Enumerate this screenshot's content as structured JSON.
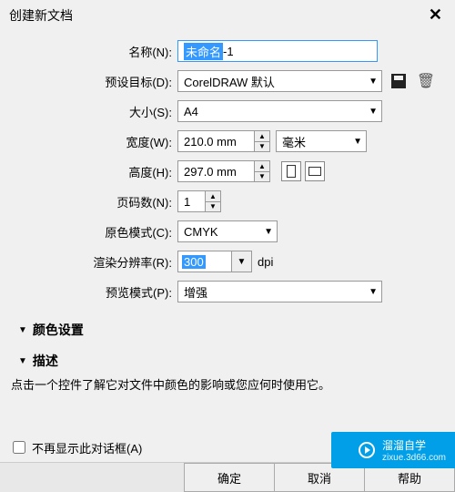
{
  "title": "创建新文档",
  "labels": {
    "name": "名称(N):",
    "preset": "预设目标(D):",
    "size": "大小(S):",
    "width": "宽度(W):",
    "height": "高度(H):",
    "pages": "页码数(N):",
    "colormode": "原色模式(C):",
    "resolution": "渲染分辨率(R):",
    "preview": "预览模式(P):"
  },
  "values": {
    "name_selected": "未命名",
    "name_rest": " -1",
    "preset": "CorelDRAW 默认",
    "size": "A4",
    "width": "210.0 mm",
    "height": "297.0 mm",
    "units": "毫米",
    "pages": "1",
    "colormode": "CMYK",
    "resolution": "300",
    "resolution_unit": "dpi",
    "preview": "增强"
  },
  "sections": {
    "color": "颜色设置",
    "desc": "描述"
  },
  "desc_text": "点击一个控件了解它对文件中颜色的影响或您应何时使用它。",
  "footer": {
    "dont_show": "不再显示此对话框(A)",
    "ok": "确定",
    "cancel": "取消",
    "help": "帮助"
  },
  "watermark": {
    "brand": "溜溜自学",
    "url": "zixue.3d66.com"
  }
}
